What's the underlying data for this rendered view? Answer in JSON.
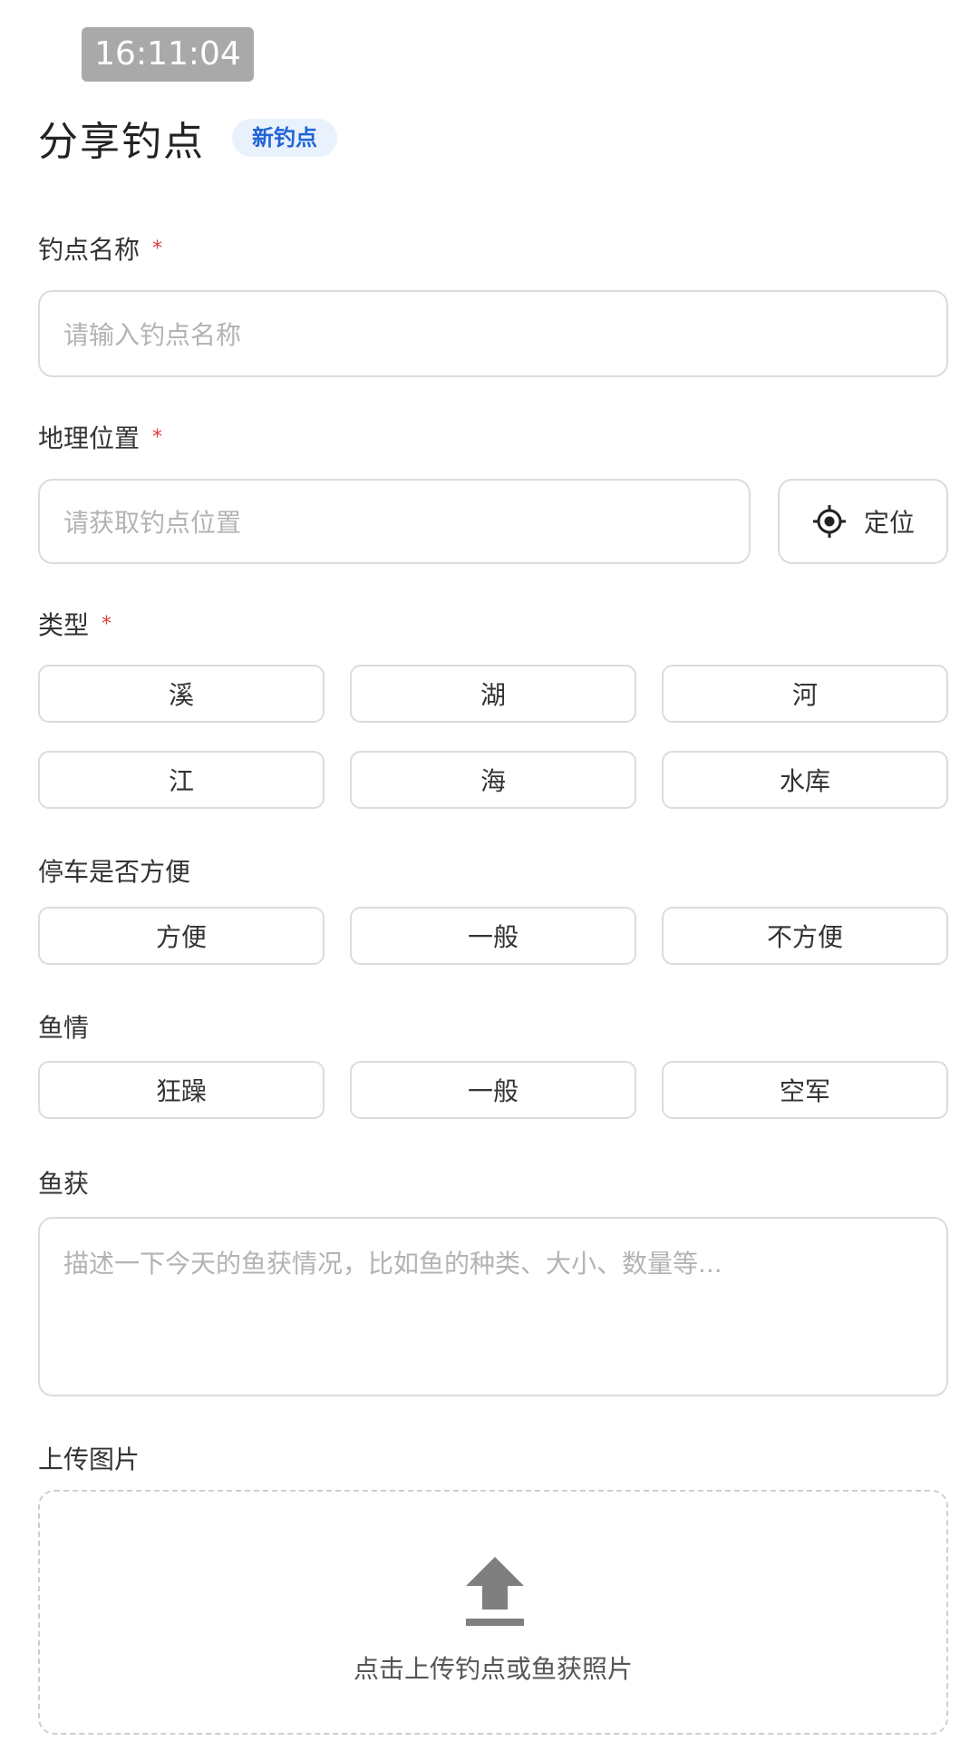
{
  "status": {
    "time": "16:11:04"
  },
  "header": {
    "title": "分享钓点",
    "badge": "新钓点"
  },
  "colors": {
    "accent": "#1f64d6",
    "badge_bg": "#e9f1fd",
    "required": "#e03b3b",
    "border": "#dcdcdc"
  },
  "form": {
    "name": {
      "label": "钓点名称",
      "required_mark": "*",
      "placeholder": "请输入钓点名称"
    },
    "location": {
      "label": "地理位置",
      "required_mark": "*",
      "placeholder": "请获取钓点位置",
      "button": "定位",
      "button_icon": "locate-icon"
    },
    "type": {
      "label": "类型",
      "required_mark": "*",
      "options": [
        "溪",
        "湖",
        "河",
        "江",
        "海",
        "水库"
      ]
    },
    "parking": {
      "label": "停车是否方便",
      "options": [
        "方便",
        "一般",
        "不方便"
      ]
    },
    "fish_condition": {
      "label": "鱼情",
      "options": [
        "狂躁",
        "一般",
        "空军"
      ]
    },
    "catch": {
      "label": "鱼获",
      "placeholder": "描述一下今天的鱼获情况，比如鱼的种类、大小、数量等..."
    },
    "upload": {
      "label": "上传图片",
      "hint": "点击上传钓点或鱼获照片",
      "icon": "upload-icon"
    }
  }
}
